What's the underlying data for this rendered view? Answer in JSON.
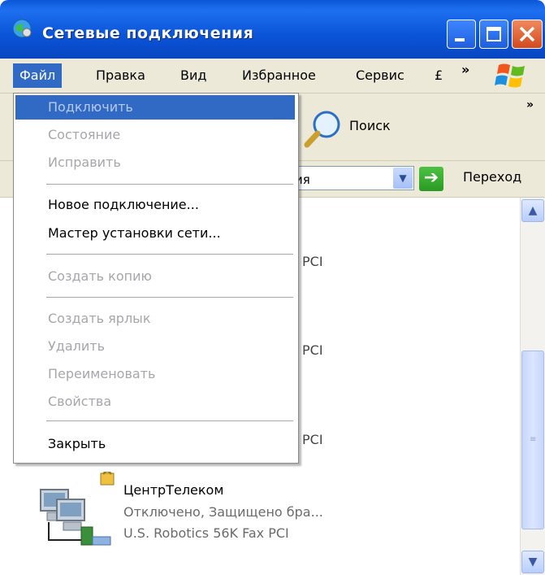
{
  "window": {
    "title": "Сетевые подключения"
  },
  "menubar": {
    "items": [
      "Файл",
      "Правка",
      "Вид",
      "Избранное",
      "Сервис",
      "£"
    ],
    "overflow": "»"
  },
  "toolbar": {
    "search_label": "Поиск",
    "overflow": "»"
  },
  "addressbar": {
    "value_fragment": "ия",
    "go_label": "Переход"
  },
  "file_menu": {
    "items": [
      {
        "label": "Подключить",
        "enabled": false,
        "highlighted": true
      },
      {
        "label": "Состояние",
        "enabled": false
      },
      {
        "label": "Исправить",
        "enabled": false
      },
      {
        "label": "Новое подключение...",
        "enabled": true
      },
      {
        "label": "Мастер установки сети...",
        "enabled": true
      },
      {
        "label": "Создать копию",
        "enabled": false
      },
      {
        "label": "Создать ярлык",
        "enabled": false
      },
      {
        "label": "Удалить",
        "enabled": false
      },
      {
        "label": "Переименовать",
        "enabled": false
      },
      {
        "label": "Свойства",
        "enabled": false
      },
      {
        "label": "Закрыть",
        "enabled": true
      }
    ]
  },
  "content": {
    "peek_texts": [
      "PCI",
      "PCI",
      "PCI"
    ],
    "connection": {
      "name": "ЦентрТелеком",
      "status": "Отключено, Защищено бра...",
      "device": "U.S. Robotics 56K Fax PCI"
    }
  },
  "colors": {
    "titlebar": "#0a54d8",
    "menu_highlight": "#316ac5",
    "chrome": "#ece9d8",
    "disabled_text": "#a7a6aa",
    "close_button": "#d24a1e"
  }
}
